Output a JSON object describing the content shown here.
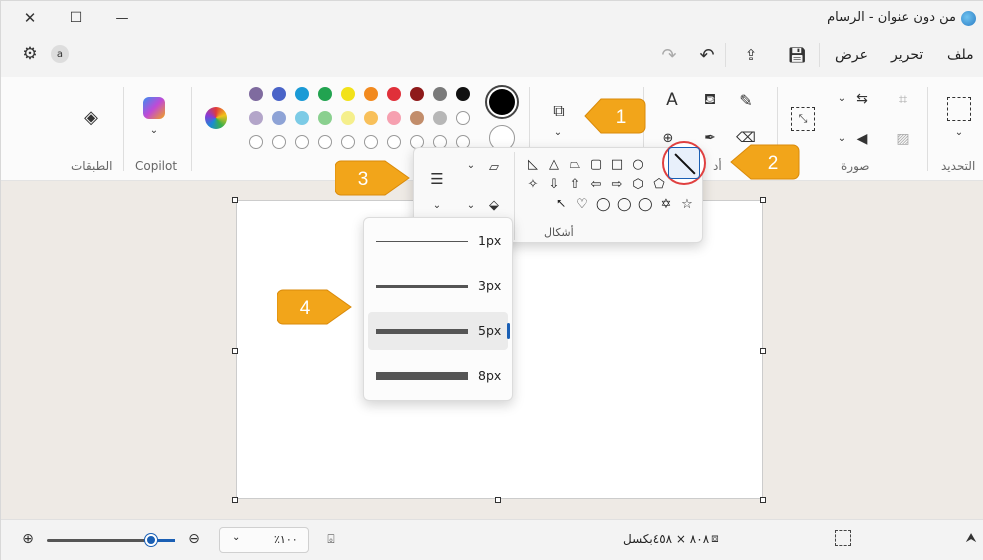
{
  "window": {
    "title": "من دون عنوان - الرسام",
    "controls": {
      "close": "✕",
      "maximize": "☐",
      "minimize": "—"
    }
  },
  "menu": {
    "file": "ملف",
    "edit": "تحرير",
    "view": "عرض",
    "user_badge": "a"
  },
  "ribbon": {
    "groups": {
      "selection": "التحديد",
      "image": "صورة",
      "tools": "أد",
      "shapes": "أشكال",
      "copilot": "Copilot",
      "layers": "الطبقات"
    },
    "colors": {
      "row1": [
        "#7f6b9f",
        "#4a64c8",
        "#1a9ad6",
        "#22a350",
        "#f2e21a",
        "#f28a1f",
        "#e0303a",
        "#8e1a1a",
        "#7a7a7a",
        "#111111"
      ],
      "row2": [
        "#b3a5c9",
        "#8ea3d6",
        "#7ccbe6",
        "#8ad08f",
        "#f5ef8c",
        "#f8c05a",
        "#f6a0b0",
        "#c28d6b",
        "#b7b7b7",
        "#ffffff"
      ],
      "primary": "#000000",
      "secondary": "#ffffff"
    }
  },
  "shapes_popup": {
    "title": "أشكال",
    "row1": [
      "◺",
      "△",
      "⏢",
      "▢",
      "□",
      "○",
      "⬠"
    ],
    "row2": [
      "✧",
      "⇩",
      "⇧",
      "⇦",
      "⇨",
      "⬡",
      "⬠"
    ],
    "row3": [
      "⭦",
      "♡",
      "◯",
      "◯",
      "◯",
      "✡",
      "☆"
    ]
  },
  "size_popup": {
    "options": [
      {
        "label": "1px",
        "thickness": 1
      },
      {
        "label": "3px",
        "thickness": 3
      },
      {
        "label": "5px",
        "thickness": 5,
        "selected": true
      },
      {
        "label": "8px",
        "thickness": 8
      }
    ]
  },
  "callouts": [
    {
      "number": "1"
    },
    {
      "number": "2"
    },
    {
      "number": "3"
    },
    {
      "number": "4"
    }
  ],
  "status": {
    "zoom_percent": "٪١٠٠",
    "canvas_size": "٨٠٨ × ٤٥٨بكسل",
    "accent": "#1a5fb4"
  },
  "colors": {
    "callout_fill": "#f2a51a",
    "callout_border": "#d98a0a",
    "highlight_ring": "#e04040"
  }
}
